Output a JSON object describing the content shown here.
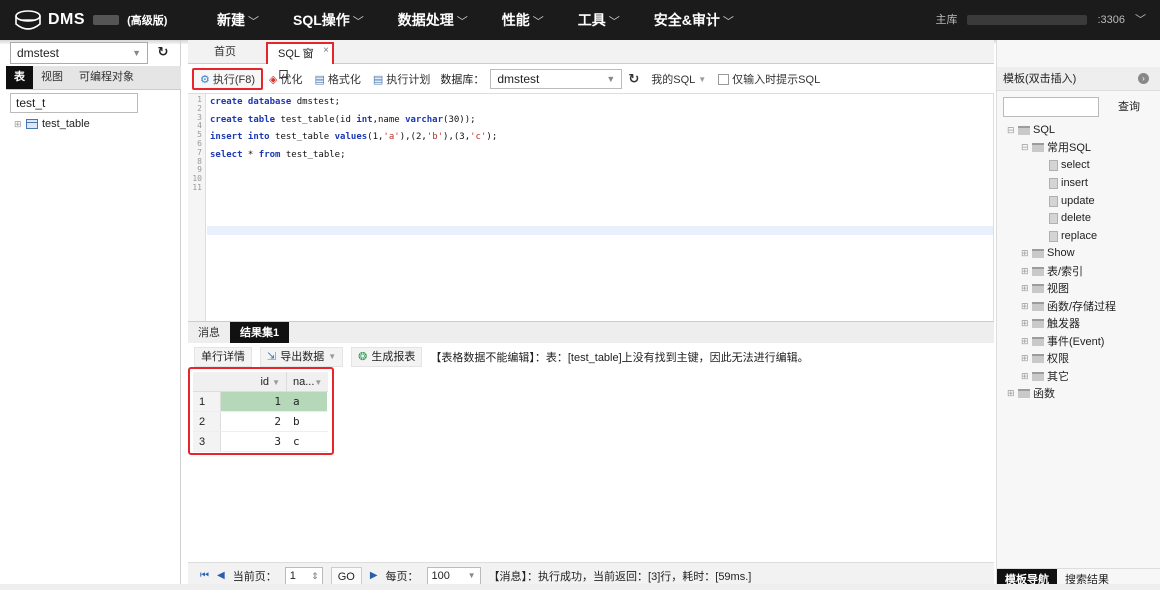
{
  "header": {
    "logo_text": "DMS",
    "edition": "(高级版)",
    "nav": [
      "新建",
      "SQL操作",
      "数据处理",
      "性能",
      "工具",
      "安全&审计"
    ],
    "role": "主库",
    "port": ":3306"
  },
  "left": {
    "db_select": "dmstest",
    "tabs": [
      "表",
      "视图",
      "可编程对象"
    ],
    "filter_value": "test_t",
    "tree_item": "test_table"
  },
  "main": {
    "tabs": {
      "home": "首页",
      "sql": "SQL 窗口",
      "close": "×"
    },
    "toolbar": {
      "execute": "执行(F8)",
      "optimize": "优化",
      "format": "格式化",
      "plan": "执行计划",
      "db_label": "数据库：",
      "db_value": "dmstest",
      "my_sql": "我的SQL",
      "hint_only": "仅输入时提示SQL"
    },
    "line_numbers": [
      "1",
      "2",
      "3",
      "4",
      "5",
      "6",
      "7",
      "8",
      "9",
      "10",
      "11"
    ],
    "code": [
      {
        "kw": "create database",
        "rest": " dmstest;"
      },
      {
        "kw": "create table",
        "rest": " test_table(id ",
        "kw2": "int",
        "rest2": ",name ",
        "kw3": "varchar",
        "rest3": "(30));"
      },
      {
        "kw": "insert into",
        "rest": " test_table ",
        "kw2": "values",
        "rest2": "(1,",
        "s1": "'a'",
        "rest3": "),(2,",
        "s2": "'b'",
        "rest4": "),(3,",
        "s3": "'c'",
        "rest5": ");"
      },
      {
        "kw": "select",
        "rest": " * ",
        "kw2": "from",
        "rest2": " test_table;"
      }
    ],
    "result_tabs": [
      "消息",
      "结果集1"
    ],
    "result_toolbar": {
      "row_detail": "单行详情",
      "export": "导出数据",
      "report": "生成报表",
      "notice": "【表格数据不能编辑】：表：[test_table]上没有找到主键，因此无法进行编辑。"
    },
    "grid": {
      "columns": [
        "id",
        "na..."
      ],
      "rows": [
        {
          "n": "1",
          "id": "1",
          "name": "a"
        },
        {
          "n": "2",
          "id": "2",
          "name": "b"
        },
        {
          "n": "3",
          "id": "3",
          "name": "c"
        }
      ]
    },
    "pager": {
      "current_label": "当前页：",
      "current": "1",
      "go": "GO",
      "per_page_label": "每页：",
      "per_page": "100",
      "message": "【消息】：执行成功，当前返回：[3]行，耗时：[59ms.]"
    }
  },
  "right": {
    "title": "模板(双击插入)",
    "query": "查询",
    "tree": {
      "sql": "SQL",
      "common": "常用SQL",
      "items": [
        "select",
        "insert",
        "update",
        "delete",
        "replace"
      ],
      "show": "Show",
      "table_index": "表/索引",
      "view": "视图",
      "func_proc": "函数/存储过程",
      "trigger": "触发器",
      "event": "事件(Event)",
      "privilege": "权限",
      "other": "其它",
      "functions": "函数"
    },
    "bottom_tabs": [
      "模板导航",
      "搜索结果"
    ]
  }
}
